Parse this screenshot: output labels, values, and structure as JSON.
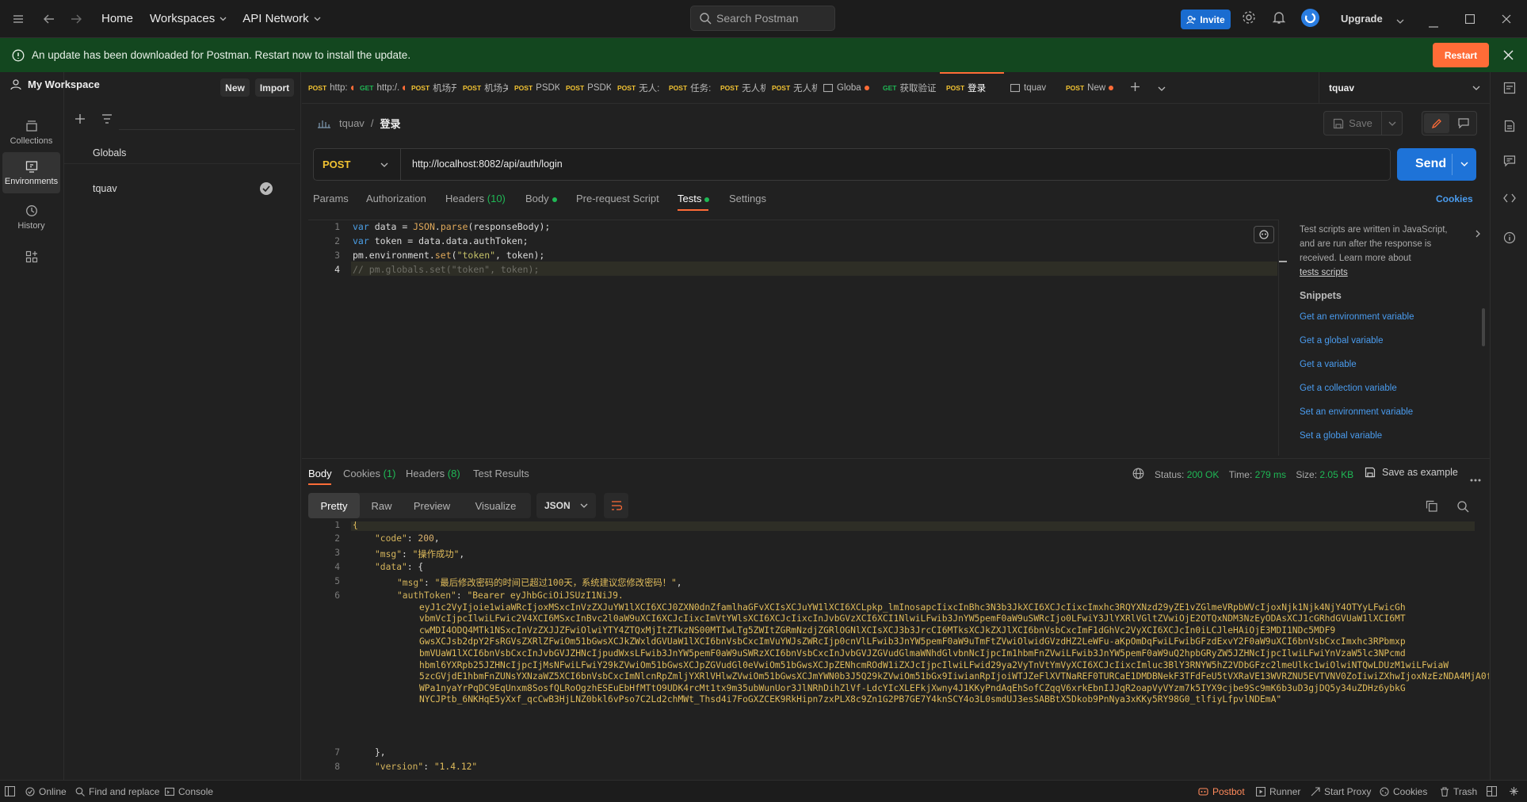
{
  "topbar": {
    "home": "Home",
    "workspaces": "Workspaces",
    "api_network": "API Network",
    "search_placeholder": "Search Postman",
    "invite": "Invite",
    "upgrade": "Upgrade"
  },
  "banner": {
    "message": "An update has been downloaded for Postman. Restart now to install the update.",
    "restart": "Restart"
  },
  "iconbar": {
    "collections": "Collections",
    "environments": "Environments",
    "history": "History"
  },
  "sidebar": {
    "workspace": "My Workspace",
    "new": "New",
    "import": "Import",
    "items": [
      "Globals",
      "tquav"
    ]
  },
  "tabs": [
    {
      "method": "POST",
      "label": "http:",
      "dot": true
    },
    {
      "method": "GET",
      "label": "http:/.",
      "dot": true
    },
    {
      "method": "POST",
      "label": "机场开",
      "dot": false
    },
    {
      "method": "POST",
      "label": "机场关",
      "dot": false
    },
    {
      "method": "POST",
      "label": "PSDK:",
      "dot": false
    },
    {
      "method": "POST",
      "label": "PSDK!",
      "dot": false
    },
    {
      "method": "POST",
      "label": "无人:",
      "dot": true
    },
    {
      "method": "POST",
      "label": "任务:",
      "dot": true
    },
    {
      "method": "POST",
      "label": "无人机",
      "dot": false
    },
    {
      "method": "POST",
      "label": "无人机",
      "dot": false
    },
    {
      "method": "",
      "label": "Globa",
      "dot": true
    },
    {
      "method": "GET",
      "label": "获取验证",
      "dot": false
    },
    {
      "method": "POST",
      "label": "登录",
      "dot": false,
      "active": true
    },
    {
      "method": "",
      "label": "tquav",
      "dot": false
    },
    {
      "method": "POST",
      "label": "New",
      "dot": true
    }
  ],
  "environment": "tquav",
  "breadcrumb": {
    "collection": "tquav",
    "sep": "/",
    "request": "登录"
  },
  "save": "Save",
  "request": {
    "method": "POST",
    "url": "http://localhost:8082/api/auth/login",
    "send": "Send"
  },
  "reqtabs": {
    "params": "Params",
    "authorization": "Authorization",
    "headers": "Headers",
    "headers_count": "(10)",
    "body": "Body",
    "prerequest": "Pre-request Script",
    "tests": "Tests",
    "settings": "Settings",
    "cookies": "Cookies"
  },
  "help": {
    "text1": "Test scripts are written in JavaScript,",
    "text2": "and are run after the response is",
    "text3": "received. Learn more about",
    "link": "tests scripts",
    "snippets_title": "Snippets",
    "snippets": [
      "Get an environment variable",
      "Get a global variable",
      "Get a variable",
      "Get a collection variable",
      "Set an environment variable",
      "Set a global variable"
    ]
  },
  "response": {
    "tabs": {
      "body": "Body",
      "cookies": "Cookies",
      "cookies_count": "(1)",
      "headers": "Headers",
      "headers_count": "(8)",
      "test_results": "Test Results"
    },
    "status_label": "Status:",
    "status": "200 OK",
    "time_label": "Time:",
    "time": "279 ms",
    "size_label": "Size:",
    "size": "2.05 KB",
    "save_example": "Save as example",
    "views": {
      "pretty": "Pretty",
      "raw": "Raw",
      "preview": "Preview",
      "visualize": "Visualize",
      "format": "JSON"
    }
  },
  "json": {
    "brace_open": "{",
    "code_key": "\"code\"",
    "code_val": "200",
    "msg_key": "\"msg\"",
    "msg_val": "\"操作成功\"",
    "data_key": "\"data\"",
    "data_open": "{",
    "inner_msg_key": "\"msg\"",
    "inner_msg_val": "\"最后修改密码的时间已超过100天，系统建议您修改密码！\"",
    "token_key": "\"authToken\"",
    "token_lines": [
      "\"Bearer eyJhbGciOiJSUzI1NiJ9.",
      "eyJ1c2VyIjoie1wiaWRcIjoxMSxcInVzZXJuYW1lXCI6XCJ0ZXN0dnZfamlhaGFvXCIsXCJuYW1lXCI6XCLpkp_lmInosapcIixcInBhc3N3b3JkXCI6XCJcIixcImxhc3RQYXNzd29yZE1vZGlmeVRpbWVcIjoxNjk1Njk4NjY4OTYyLFwicGh",
      "vbmVcIjpcIlwiLFwic2V4XCI6MSxcInBvc2l0aW9uXCI6XCJcIixcImVtYWlsXCI6XCJcIixcInJvbGVzXCI6XCI1NlwiLFwib3JnYW5pemF0aW9uSWRcIjo0LFwiY3JlYXRlVGltZVwiOjE2OTQxNDM3NzEyODAsXCJ1cGRhdGVUaW1lXCI6MT",
      "cwMDI4ODQ4MTk1NSxcInVzZXJJZFwiOlwiYTY4ZTQxMjItZTkzNS00MTIwLTg5ZWItZGRmNzdjZGRlOGNlXCIsXCJ3b3JrcCI6MTksXCJkZXJlXCI6bnVsbCxcImF1dGhVc2VyXCI6XCJcIn0iLCJleHAiOjE3MDI1NDc5MDF9",
      "GwsXCJsb2dpY2FsRGVsZXRlZFwiOm51bGwsXCJkZWxldGVUaW1lXCI6bnVsbCxcImVuYWJsZWRcIjp0cnVlLFwib3JnYW5pemF0aW9uTmFtZVwiOlwidGVzdHZ2LeWFu-aKpOmDqFwiLFwibGFzdExvY2F0aW9uXCI6bnVsbCxcImxhc3RPbmxp",
      "bmVUaW1lXCI6bnVsbCxcInJvbGVJZHNcIjpudWxsLFwib3JnYW5pemF0aW9uSWRzXCI6bnVsbCxcInJvbGVJZGVudGlmaWNhdGlvbnNcIjpcIm1hbmFnZVwiLFwib3JnYW5pemF0aW9uQ2hpbGRyZW5JZHNcIjpcIlwiLFwiYnVzaW5lc3NPcmd",
      "hbml6YXRpb25JZHNcIjpcIjMsNFwiLFwiY29kZVwiOm51bGwsXCJpZGVudGl0eVwiOm51bGwsXCJpZENhcmROdW1iZXJcIjpcIlwiLFwid29ya2VyTnVtYmVyXCI6XCJcIixcImluc3BlY3RNYW5hZ2VDbGFzc2lmeUlkc1wiOlwiNTQwLDUzM1wiLFwiaW",
      "5zcGVjdE1hbmFnZUNsYXNzaWZ5XCI6bnVsbCxcImNlcnRpZmljYXRlVHlwZVwiOm51bGwsXCJmYWN0b3J5Q29kZVwiOm51bGx9IiwianRpIjoiWTJZeFlXVTNaREF0TURCaE1DMDBNekF3TFdFeU5tVXRaVE13WVRZNU5EVTVNV0ZoIiwiZXhwIjoxNzEzNDA4MjA0fQ.",
      "WPa1nyaYrPqDC9EqUnxm8SosfQLRoOgzhESEuEbHfMTtO9UDK4rcMt1tx9m35ubWunUor3JlNRhDihZlVf-LdcYIcXLEFkjXwny4J1KKyPndAqEhSofCZqqV6xrkEbnIJJqR2oapVyVYzm7k5IYX9cjbe9Sc9mK6b3uD3gjDQ5y34uZDHz6ybkG",
      "NYCJPtb_6NKHqE5yXxf_qcCwB3HjLNZ0bkl6vPso7C2Ld2chMWt_Thsd4i7FoGXZCEK9RkHipn7zxPLX8c9Zn1G2PB7GE7Y4knSCY4o3L0smdUJ3esSABBtX5Dkob9PnNya3xKKy5RY98G0_tlfiyLfpvlNDEmA\""
    ],
    "data_close": "},",
    "version_key": "\"version\"",
    "version_val": "\"1.4.12\""
  },
  "statusbar": {
    "online": "Online",
    "find_replace": "Find and replace",
    "console": "Console",
    "postbot": "Postbot",
    "runner": "Runner",
    "start_proxy": "Start Proxy",
    "cookies": "Cookies",
    "trash": "Trash"
  }
}
